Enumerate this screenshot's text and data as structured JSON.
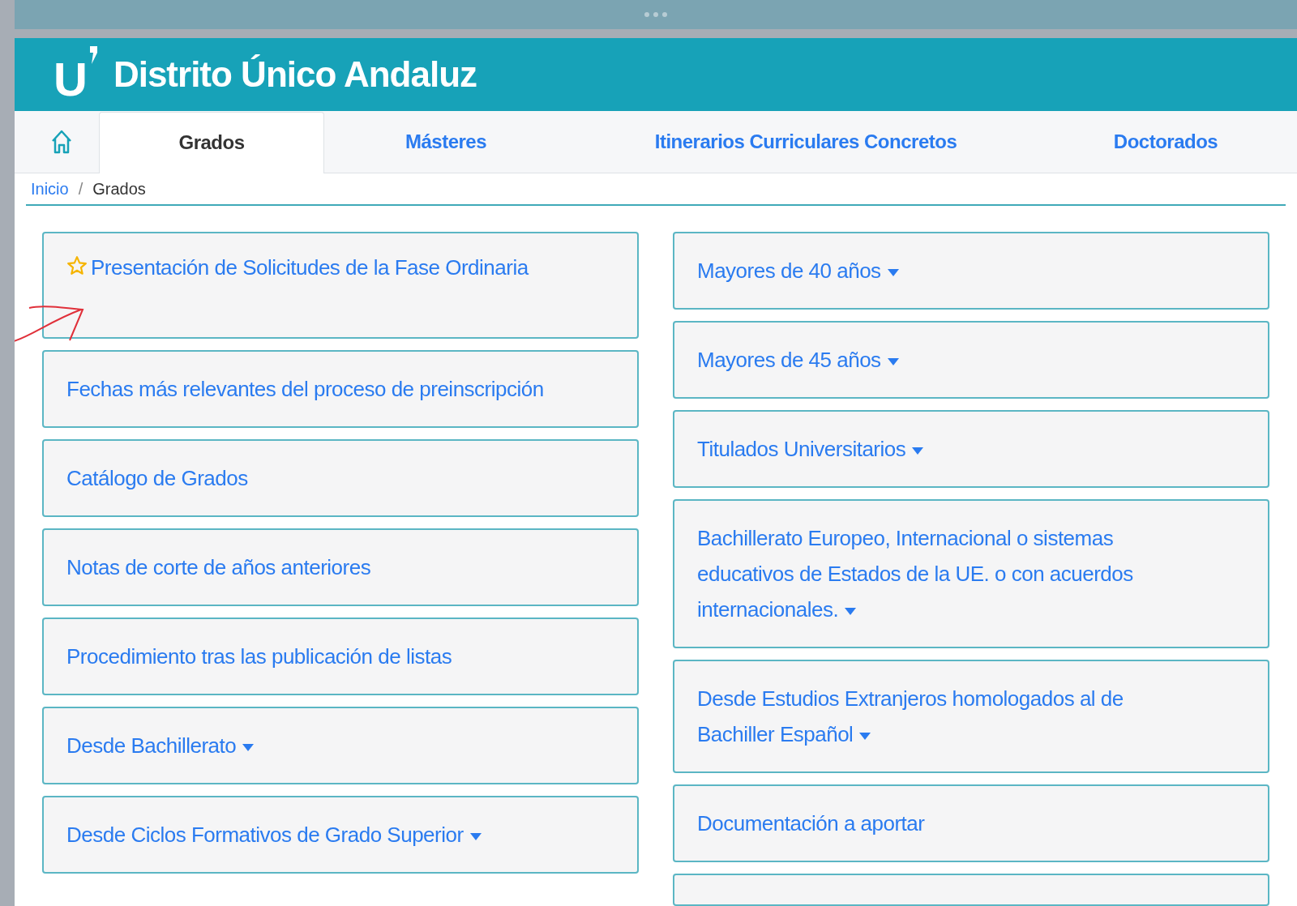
{
  "header": {
    "logo_mark": "U",
    "title": "Distrito Único Andaluz"
  },
  "tabs": [
    {
      "label": "Grados",
      "selected": true
    },
    {
      "label": "Másteres",
      "selected": false
    },
    {
      "label": "Itinerarios Curriculares Concretos",
      "selected": false
    },
    {
      "label": "Doctorados",
      "selected": false
    }
  ],
  "breadcrumb_separator": "/",
  "breadcrumb": [
    {
      "label": "Inicio",
      "kind": "link"
    },
    {
      "label": "Grados",
      "kind": "current"
    }
  ],
  "left_items": [
    {
      "label": "Presentación de Solicitudes de la Fase Ordinaria",
      "kind": "featured"
    },
    {
      "label": "Fechas más relevantes del proceso de preinscripción",
      "kind": "link"
    },
    {
      "label": "Catálogo de Grados",
      "kind": "link"
    },
    {
      "label": "Notas de corte de años anteriores",
      "kind": "link"
    },
    {
      "label": "Procedimiento tras las publicación de listas",
      "kind": "link"
    },
    {
      "label": "Desde Bachillerato",
      "kind": "dropdown"
    },
    {
      "label": "Desde Ciclos Formativos de Grado Superior",
      "kind": "dropdown"
    }
  ],
  "right_items": [
    {
      "label": "Mayores de 40 años",
      "kind": "dropdown"
    },
    {
      "label": "Mayores de 45 años",
      "kind": "dropdown"
    },
    {
      "label": "Titulados Universitarios",
      "kind": "dropdown"
    },
    {
      "label": "Bachillerato Europeo, Internacional o sistemas educativos de Estados de la UE. o con acuerdos internacionales.",
      "kind": "dropdown"
    },
    {
      "label": "Desde Estudios Extranjeros homologados al de Bachiller Español",
      "kind": "dropdown"
    },
    {
      "label": "Documentación a aportar",
      "kind": "link"
    }
  ]
}
